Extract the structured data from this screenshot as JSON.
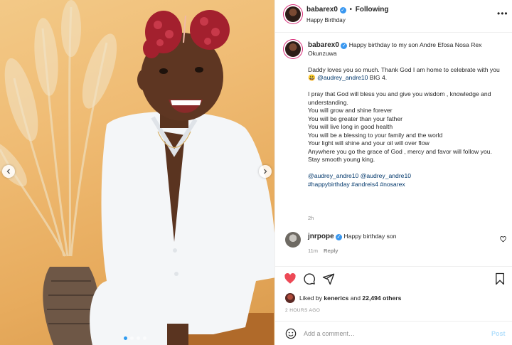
{
  "post": {
    "image_alt": "Smiling child in white outfit",
    "carousel_dots": 4,
    "carousel_active": 0
  },
  "header": {
    "username": "babarex0",
    "separator": "•",
    "follow_state": "Following",
    "subtitle": "Happy Birthday",
    "more_label": "•••"
  },
  "caption": {
    "username": "babarex0",
    "first_line": "Happy birthday to my son Andre Efosa Nosa Rex Okunzuwa",
    "para2_pre": "Daddy loves you so much. Thank God I am home to celebrate with you 😃 ",
    "para2_mention": "@audrey_andre10",
    "para2_post": " BIG 4.",
    "lines": [
      "I pray that God will bless you and give you wisdom , knowledge and understanding.",
      "You will grow and shine forever",
      "You will be greater than your father",
      "You will live long in good health",
      "You will be a blessing to your family and the world",
      "Your light will shine and your oil will over flow",
      "Anywhere you go the grace of God , mercy and favor will follow you. Stay smooth young king."
    ],
    "tags_line1": "@audrey_andre10 @audrey_andre10",
    "tags_line2": "#happybirthday #andreis4 #nosarex",
    "time": "2h"
  },
  "comment": {
    "username": "jnrpope",
    "text": "Happy birthday son",
    "time": "11m",
    "reply_label": "Reply"
  },
  "likes": {
    "prefix": "Liked by",
    "first_liker": "kenerics",
    "conjunction": "and",
    "others": "22,494 others"
  },
  "date": "2 HOURS AGO",
  "add_comment": {
    "placeholder": "Add a comment…",
    "post_label": "Post"
  },
  "colors": {
    "like_active": "#ed4956",
    "link": "#00376b",
    "verified": "#3897f0",
    "post_disabled": "#b2dffc"
  },
  "icons": [
    "heart-filled-icon",
    "comment-icon",
    "share-icon",
    "bookmark-icon",
    "emoji-icon",
    "chevron-left-icon",
    "chevron-right-icon",
    "verified-icon",
    "more-icon"
  ]
}
